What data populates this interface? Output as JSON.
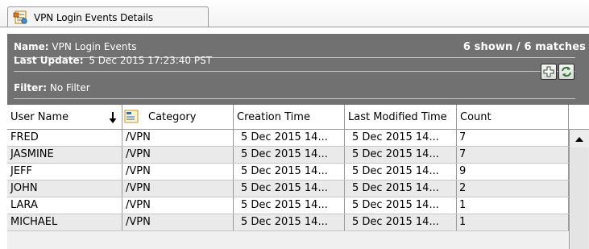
{
  "tab": {
    "label": "VPN Login Events Details",
    "icon": "report-icon"
  },
  "info": {
    "name_label": "Name:",
    "name_value": "VPN Login Events",
    "update_label": "Last Update:",
    "update_value": "5 Dec 2015 17:23:40 PST",
    "filter_label": "Filter:",
    "filter_value": "No Filter",
    "matches": "6 shown / 6 matches",
    "buttons": [
      "add-icon",
      "refresh-icon"
    ]
  },
  "grid": {
    "columns": [
      "User Name",
      "Category",
      "Creation Time",
      "Last Modified Time",
      "Count"
    ],
    "sort_column": "User Name",
    "sort_direction": "descending",
    "rows": [
      {
        "user": "FRED",
        "category": "/VPN",
        "created": "5 Dec 2015 14...",
        "modified": "5 Dec 2015 14...",
        "count": "7"
      },
      {
        "user": "JASMINE",
        "category": "/VPN",
        "created": "5 Dec 2015 14...",
        "modified": "5 Dec 2015 14...",
        "count": "7"
      },
      {
        "user": "JEFF",
        "category": "/VPN",
        "created": "5 Dec 2015 14...",
        "modified": "5 Dec 2015 14...",
        "count": "9"
      },
      {
        "user": "JOHN",
        "category": "/VPN",
        "created": "5 Dec 2015 14...",
        "modified": "5 Dec 2015 14...",
        "count": "2"
      },
      {
        "user": "LARA",
        "category": "/VPN",
        "created": "5 Dec 2015 14...",
        "modified": "5 Dec 2015 14...",
        "count": "1"
      },
      {
        "user": "MICHAEL",
        "category": "/VPN",
        "created": "5 Dec 2015 14...",
        "modified": "5 Dec 2015 14...",
        "count": "1"
      }
    ]
  },
  "colors": {
    "header_bg": "#717171",
    "row_alt": "#eaeaea",
    "border": "#9a9a9a"
  }
}
